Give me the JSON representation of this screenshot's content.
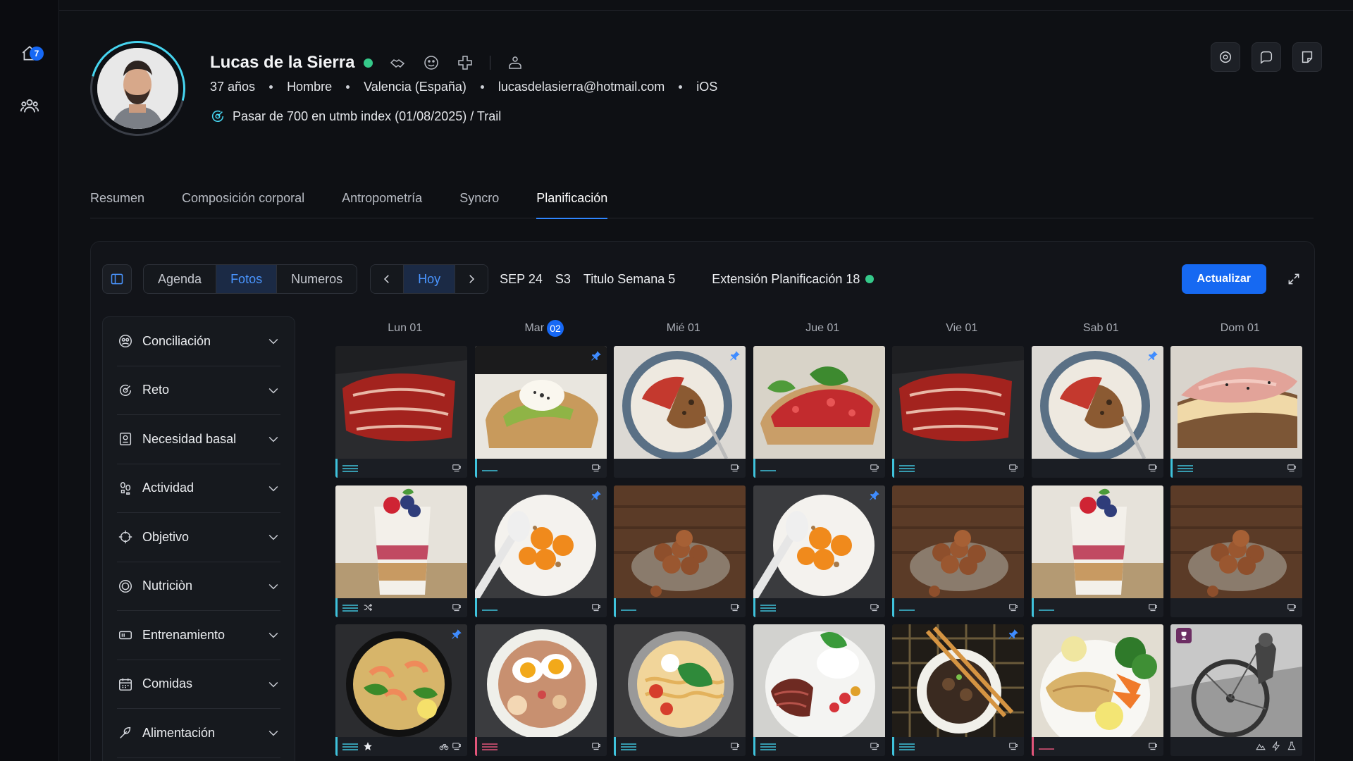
{
  "nav": {
    "home_badge": "7"
  },
  "profile": {
    "name": "Lucas de la Sierra",
    "age": "37 años",
    "gender": "Hombre",
    "location": "Valencia (España)",
    "email": "lucasdelasierra@hotmail.com",
    "platform": "iOS",
    "goal": "Pasar de 700 en utmb index (01/08/2025) / Trail"
  },
  "tabs": [
    {
      "label": "Resumen"
    },
    {
      "label": "Composición corporal"
    },
    {
      "label": "Antropometría"
    },
    {
      "label": "Syncro"
    },
    {
      "label": "Planificación",
      "active": true
    }
  ],
  "toolbar": {
    "views": [
      "Agenda",
      "Fotos",
      "Numeros"
    ],
    "active_view": "Fotos",
    "today": "Hoy",
    "month": "SEP 24",
    "week": "S3",
    "week_title": "Titulo Semana 5",
    "extension": "Extensión Planificación 18",
    "update": "Actualizar"
  },
  "sidebar": {
    "items": [
      {
        "label": "Conciliación",
        "icon": "conciliation-icon"
      },
      {
        "label": "Reto",
        "icon": "challenge-icon"
      },
      {
        "label": "Necesidad basal",
        "icon": "basal-icon"
      },
      {
        "label": "Actividad",
        "icon": "activity-icon"
      },
      {
        "label": "Objetivo",
        "icon": "target-icon"
      },
      {
        "label": "Nutriciòn",
        "icon": "nutrition-icon"
      },
      {
        "label": "Entrenamiento",
        "icon": "training-icon"
      },
      {
        "label": "Comidas",
        "icon": "calendar-icon"
      },
      {
        "label": "Alimentación",
        "icon": "food-icon"
      }
    ]
  },
  "calendar": {
    "days": [
      {
        "label": "Lun 01"
      },
      {
        "label": "Mar",
        "badge": "02"
      },
      {
        "label": "Mié 01"
      },
      {
        "label": "Jue 01"
      },
      {
        "label": "Vie 01"
      },
      {
        "label": "Sab 01"
      },
      {
        "label": "Dom 01"
      }
    ],
    "meals": [
      [
        "jamon",
        "avocado-toast",
        "granola-bowl",
        "tomato-toast",
        "jamon",
        "granola-bowl",
        "ham-sandwich"
      ],
      [
        "yogurt-parfait",
        "orange-plate",
        "hazelnuts",
        "orange-plate",
        "hazelnuts",
        "yogurt-parfait",
        "hazelnuts"
      ],
      [
        "shrimp-pasta",
        "egg-stew",
        "spaghetti",
        "steak-rice",
        "ramen",
        "fish-veg",
        "cycling-photo"
      ]
    ]
  },
  "colors": {
    "accent": "#1668f5",
    "ring": "#46d5f0",
    "online": "#35c98a",
    "bar": "#3fc3dc",
    "bar_alt": "#e3557a"
  }
}
